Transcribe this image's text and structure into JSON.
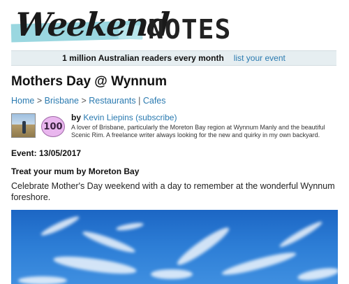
{
  "logo": {
    "word1": "Weekend",
    "word2": "NOTES"
  },
  "banner": {
    "text": "1 million Australian readers every month",
    "link": "list your event"
  },
  "article": {
    "title": "Mothers Day @ Wynnum",
    "breadcrumbs": {
      "home": "Home",
      "city": "Brisbane",
      "cat1": "Restaurants",
      "cat2": "Cafes"
    },
    "score": "100",
    "author": {
      "by": "by",
      "name": "Kevin Liepins",
      "subscribe": "subscribe",
      "bio": "A lover of Brisbane, particularly the Moreton Bay region at Wynnum Manly and the beautiful Scenic Rim. A freelance writer always looking for the new and quirky in my own backyard."
    },
    "event": "Event: 13/05/2017",
    "subheading": "Treat your mum by Moreton Bay",
    "intro": "Celebrate Mother's Day weekend with a day to remember at the wonderful Wynnum foreshore."
  },
  "colors": {
    "link": "#2a7ab0",
    "banner_bg": "#e6eef1",
    "tape": "#8fd3dd",
    "score_badge": "#e9b6ee",
    "sky": "#2d7ed6"
  },
  "icons": {
    "hero": "sky-photo",
    "avatar": "author-photo"
  }
}
